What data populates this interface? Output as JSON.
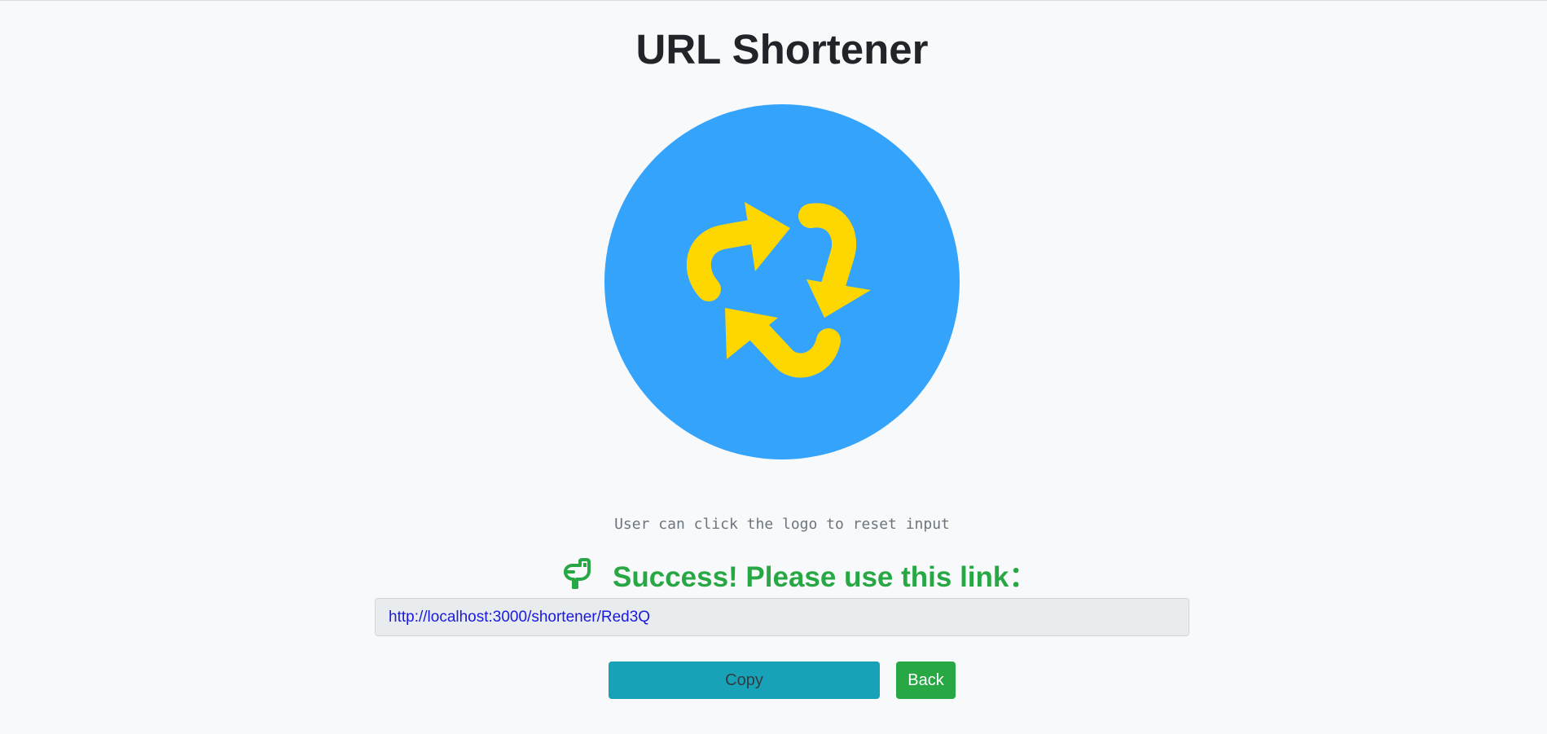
{
  "header": {
    "title": "URL Shortener"
  },
  "logo": {
    "icon": "recycle-arrows-icon",
    "circle_color": "#33a3fc",
    "arrow_color": "#ffd700"
  },
  "hint": {
    "text": "User can click the logo to reset input"
  },
  "result": {
    "icon": "pointing-hand-icon",
    "message": "Success! Please use this link：",
    "message_color": "#28a745",
    "short_url": "http://localhost:3000/shortener/Red3Q"
  },
  "actions": {
    "copy_label": "Copy",
    "back_label": "Back",
    "copy_color": "#17a2b8",
    "back_color": "#28a745"
  }
}
